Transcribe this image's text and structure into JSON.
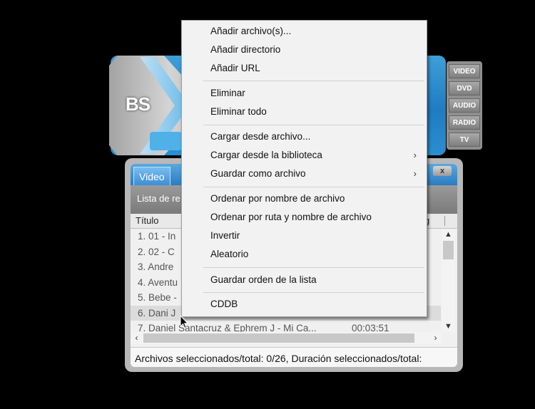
{
  "player": {
    "logo": "BS",
    "side_buttons": [
      "VIDEO",
      "DVD",
      "AUDIO",
      "RADIO",
      "TV"
    ]
  },
  "playlist": {
    "tab_label": "Video",
    "close_symbol": "x",
    "list_label": "Lista de re",
    "column_title": "Título",
    "column_right_fragment": "g",
    "rows": [
      {
        "text": "1. 01 - In",
        "time": ""
      },
      {
        "text": "2. 02 - C",
        "time": ""
      },
      {
        "text": "3. Andre",
        "time": ""
      },
      {
        "text": "4. Aventu",
        "time": ""
      },
      {
        "text": "5. Bebe -",
        "time": ""
      },
      {
        "text": "6. Dani J",
        "time": "",
        "selected": true
      },
      {
        "text": "7. Daniel Santacruz & Ephrem J - Mi Ca...",
        "time": "00:03:51"
      }
    ],
    "status": "Archivos seleccionados/total: 0/26, Duración seleccionados/total:"
  },
  "context_menu": {
    "items": [
      {
        "label": "Añadir archivo(s)...",
        "submenu": false
      },
      {
        "label": "Añadir directorio",
        "submenu": false
      },
      {
        "label": "Añadir URL",
        "submenu": false
      },
      {
        "label": "Eliminar",
        "submenu": false
      },
      {
        "label": "Eliminar todo",
        "submenu": false
      },
      {
        "label": "Cargar desde archivo...",
        "submenu": false
      },
      {
        "label": "Cargar desde la biblioteca",
        "submenu": true
      },
      {
        "label": "Guardar como archivo",
        "submenu": true
      },
      {
        "label": "Ordenar por nombre de archivo",
        "submenu": false
      },
      {
        "label": "Ordenar por ruta y nombre de archivo",
        "submenu": false
      },
      {
        "label": "Invertir",
        "submenu": false
      },
      {
        "label": "Aleatorio",
        "submenu": false
      },
      {
        "label": "Guardar orden de la lista",
        "submenu": false
      },
      {
        "label": "CDDB",
        "submenu": false
      }
    ],
    "submenu_arrow": "›"
  },
  "icons": {
    "scroll_up": "▲",
    "scroll_down": "▼",
    "scroll_left": "‹",
    "scroll_right": "›"
  }
}
